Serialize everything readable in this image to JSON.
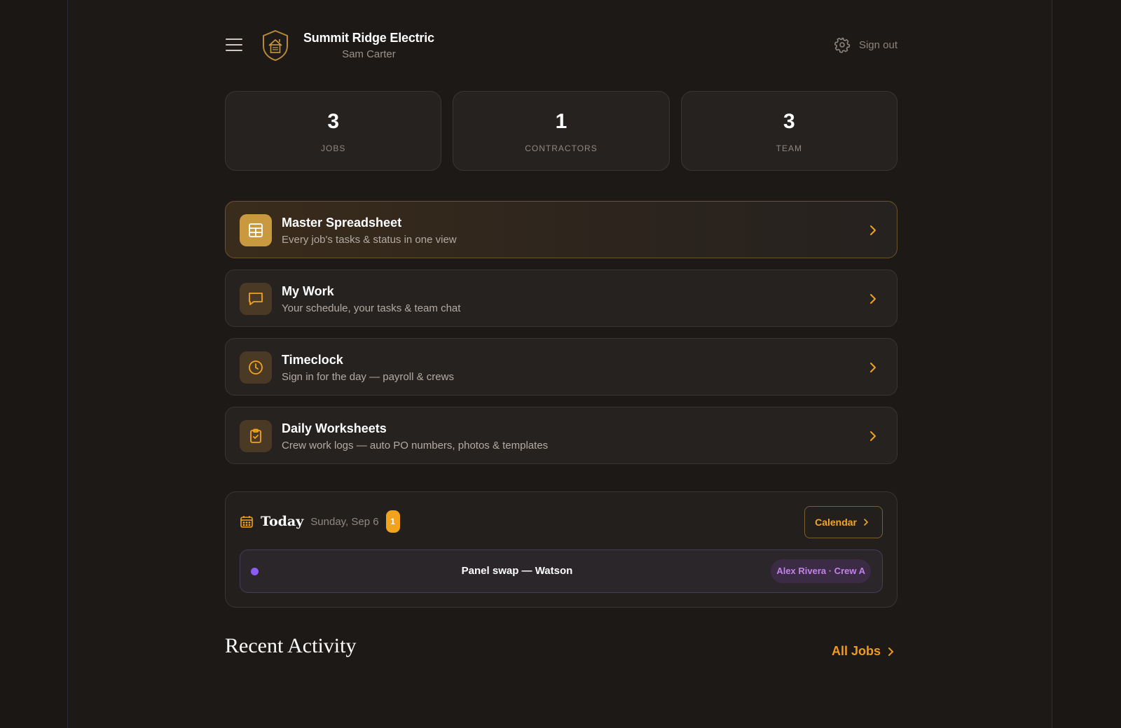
{
  "header": {
    "company": "Summit Ridge Electric",
    "user": "Sam Carter",
    "sign_out": "Sign out"
  },
  "stats": [
    {
      "value": "3",
      "label": "JOBS"
    },
    {
      "value": "1",
      "label": "CONTRACTORS"
    },
    {
      "value": "3",
      "label": "TEAM"
    }
  ],
  "nav": [
    {
      "title": "Master Spreadsheet",
      "subtitle": "Every job's tasks & status in one view",
      "icon": "table-icon"
    },
    {
      "title": "My Work",
      "subtitle": "Your schedule, your tasks & team chat",
      "icon": "chat-icon"
    },
    {
      "title": "Timeclock",
      "subtitle": "Sign in for the day — payroll & crews",
      "icon": "clock-icon"
    },
    {
      "title": "Daily Worksheets",
      "subtitle": "Crew work logs — auto PO numbers, photos & templates",
      "icon": "clipboard-check-icon"
    }
  ],
  "today": {
    "title": "Today",
    "date": "Sunday, Sep 6",
    "count": "1",
    "calendar_label": "Calendar",
    "events": [
      {
        "title": "Panel swap — Watson",
        "assignee": "Alex Rivera · Crew A",
        "dot_color": "#8b5cf6"
      }
    ]
  },
  "recent": {
    "title": "Recent Activity",
    "all_jobs_label": "All Jobs"
  },
  "colors": {
    "accent": "#f2a21b",
    "background": "#1c1917",
    "card": "#262220",
    "event_purple": "#8b5cf6"
  }
}
